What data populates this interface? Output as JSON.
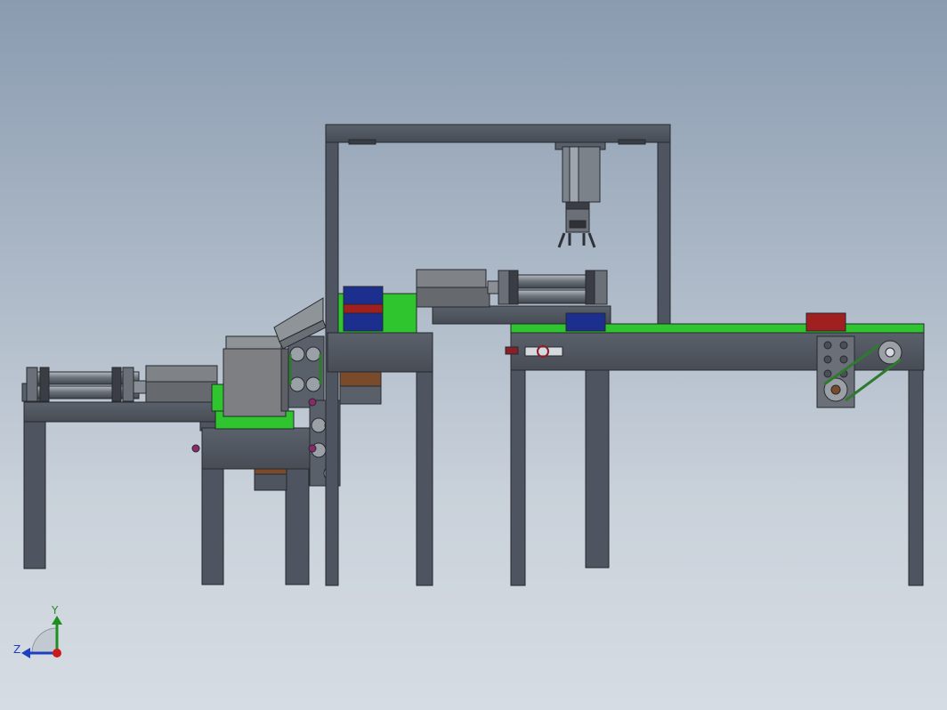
{
  "view": {
    "triad": {
      "y_label": "Y",
      "z_label": "Z",
      "y_color": "#1f8f1f",
      "z_color": "#1e3fbf",
      "x_color": "#cc1a1a"
    }
  },
  "colors": {
    "frame": "#4f5560",
    "frame_edge": "#26292e",
    "belt": "#2ec52e",
    "box_blue": "#1c2f8f",
    "box_red": "#a01f1f",
    "cylinder": "#7c828a",
    "cover": "#7d7f82",
    "brown": "#7a4b2a",
    "drive_belt": "#2f7a2f"
  }
}
